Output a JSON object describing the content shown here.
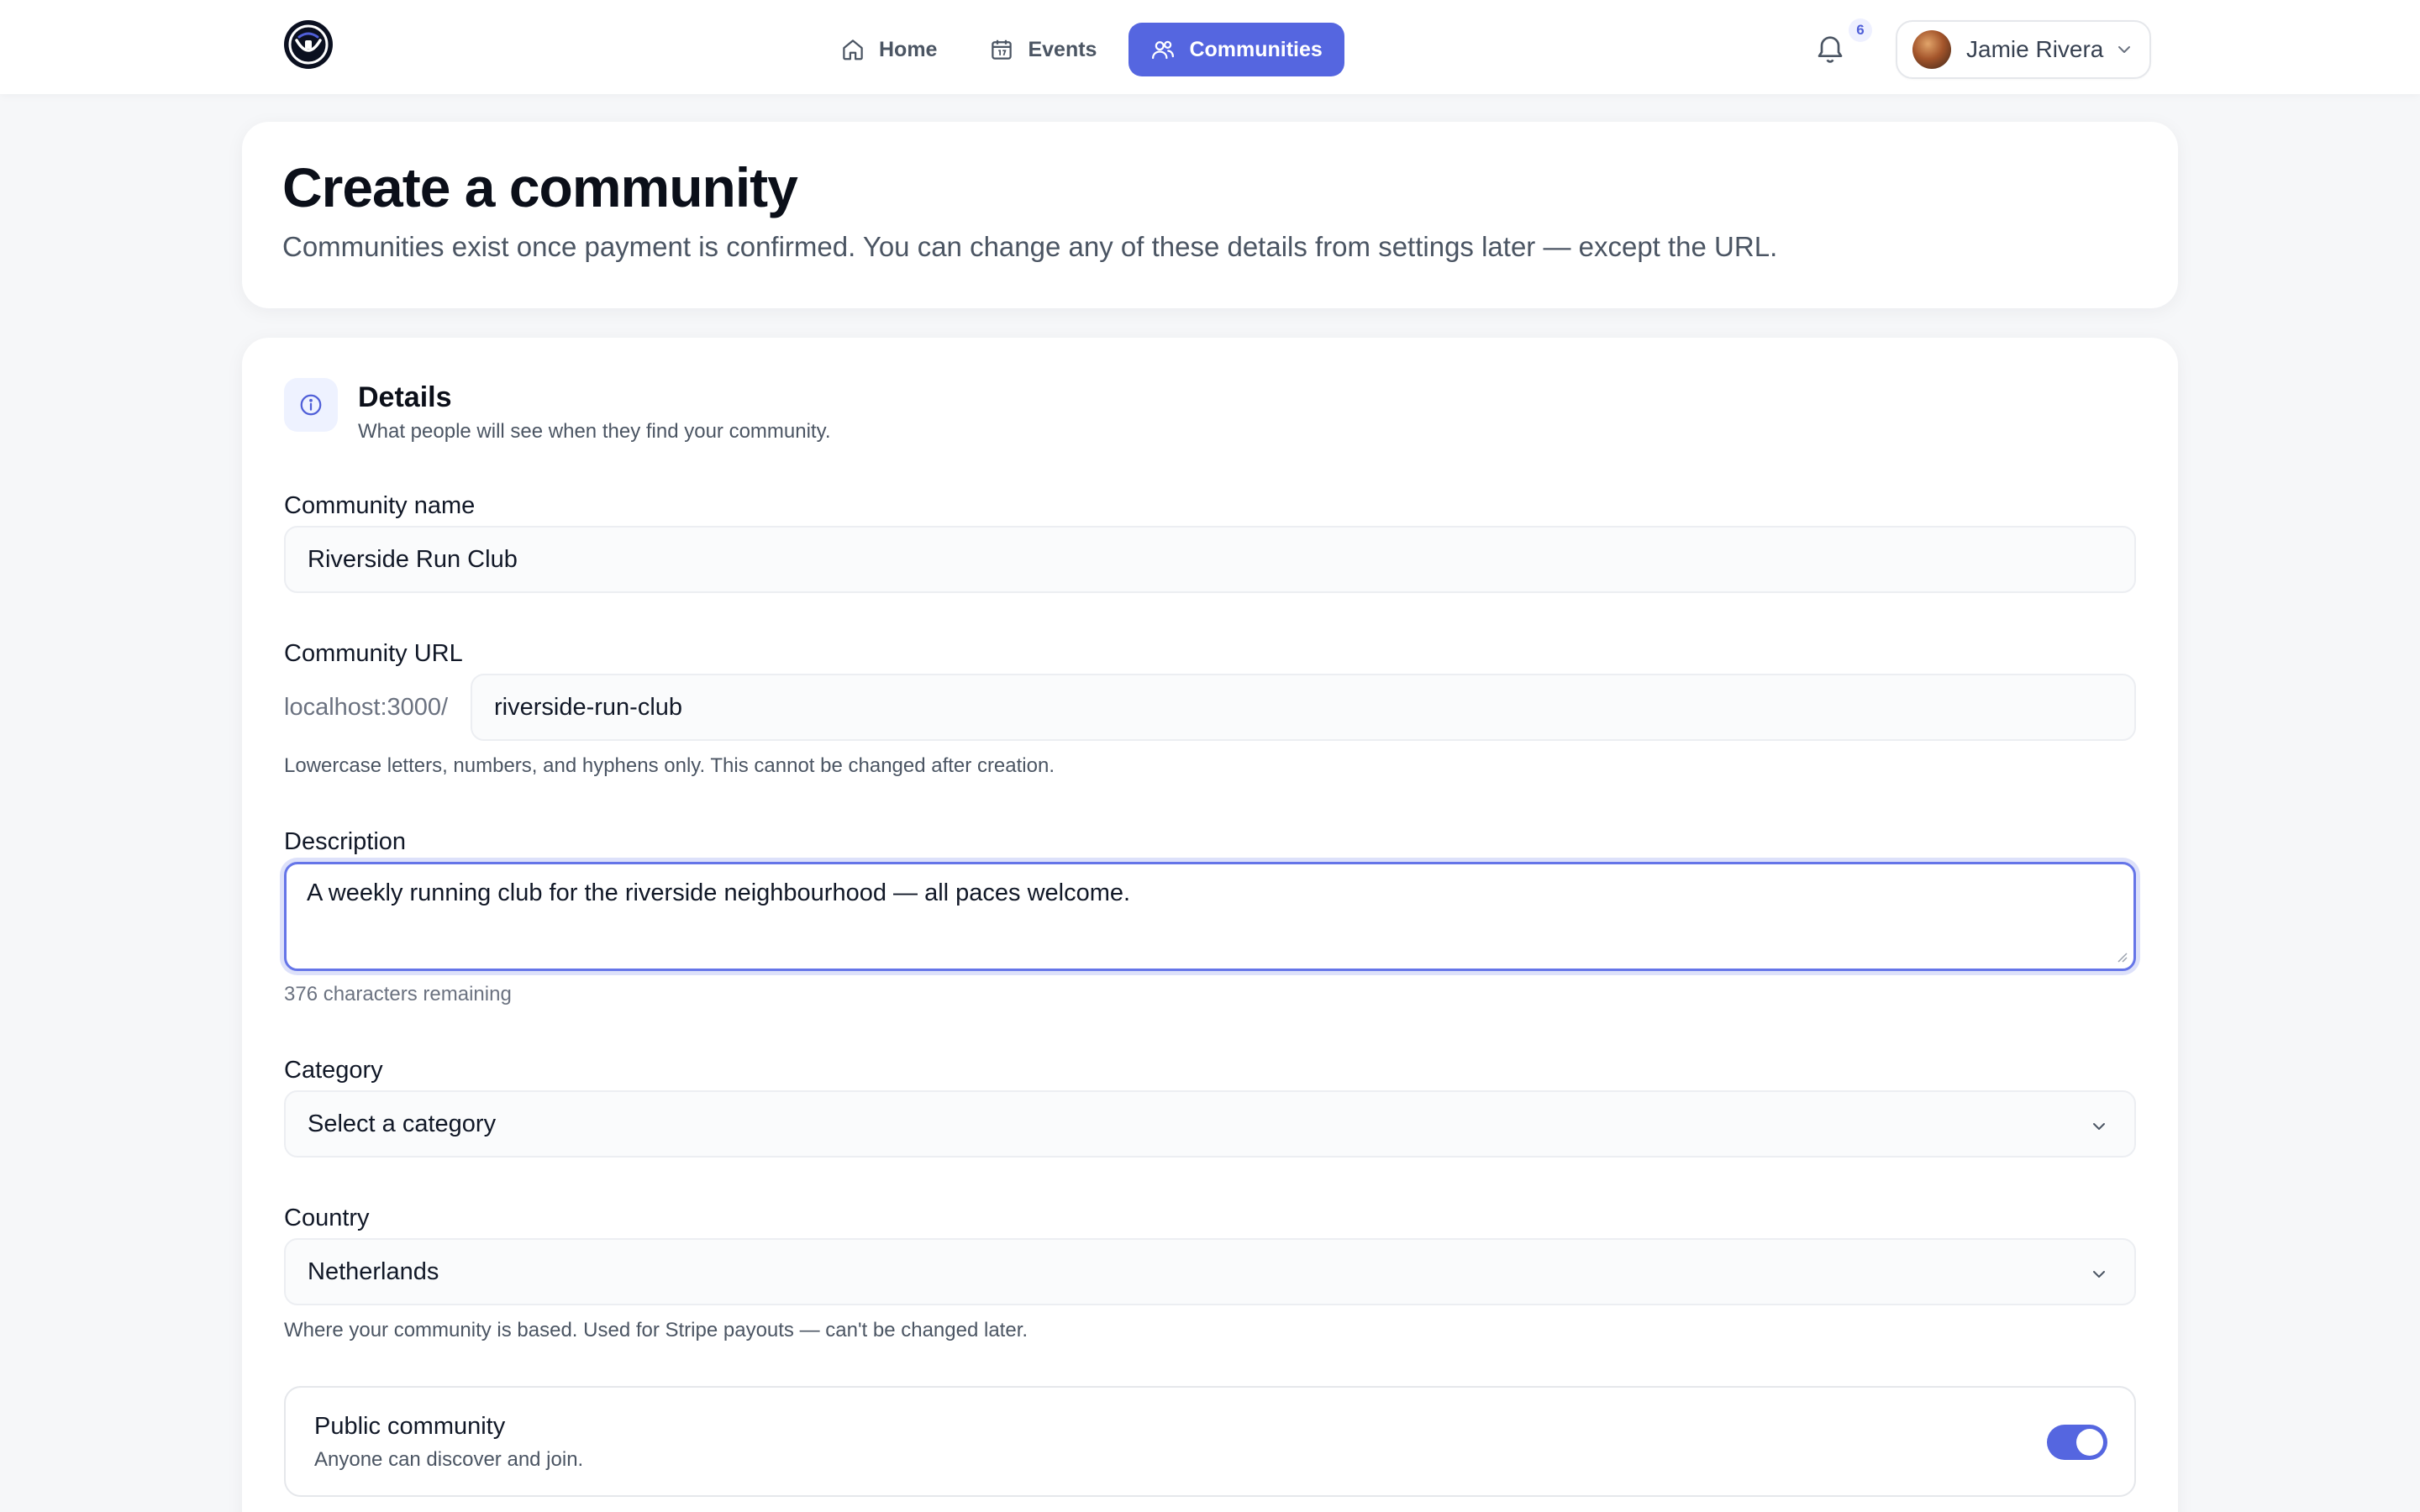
{
  "nav": {
    "items": [
      {
        "label": "Home",
        "icon": "home-icon",
        "active": false
      },
      {
        "label": "Events",
        "icon": "calendar-icon",
        "active": false
      },
      {
        "label": "Communities",
        "icon": "users-icon",
        "active": true
      }
    ],
    "notification_count": "6",
    "user_name": "Jamie Rivera"
  },
  "header": {
    "title": "Create a community",
    "subtitle": "Communities exist once payment is confirmed. You can change any of these details from settings later — except the URL."
  },
  "details": {
    "title": "Details",
    "subtitle": "What people will see when they find your community.",
    "name": {
      "label": "Community name",
      "value": "Riverside Run Club"
    },
    "url": {
      "label": "Community URL",
      "prefix": "localhost:3000/",
      "value": "riverside-run-club",
      "help": "Lowercase letters, numbers, and hyphens only. This cannot be changed after creation."
    },
    "description": {
      "label": "Description",
      "value": "A weekly running club for the riverside neighbourhood — all paces welcome.",
      "remaining": "376 characters remaining"
    },
    "category": {
      "label": "Category",
      "value": "Select a category"
    },
    "country": {
      "label": "Country",
      "value": "Netherlands",
      "help": "Where your community is based. Used for Stripe payouts — can't be changed later."
    },
    "public": {
      "title": "Public community",
      "subtitle": "Anyone can discover and join.",
      "enabled": true
    }
  },
  "colors": {
    "accent": "#5566e0",
    "background": "#f6f7f9",
    "badge_text": "#4f5fd8"
  }
}
